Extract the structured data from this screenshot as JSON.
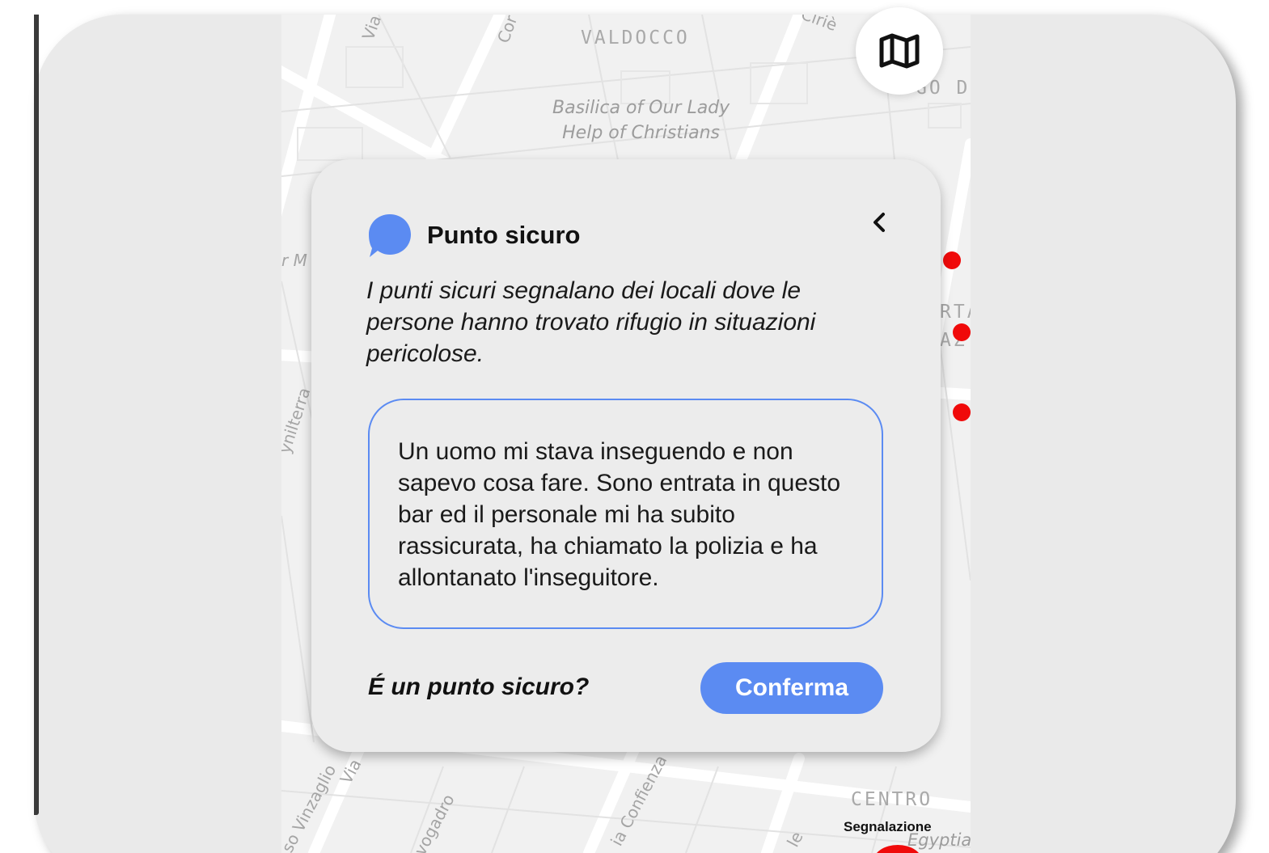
{
  "map": {
    "labels": {
      "valdocco": "VALDOCCO",
      "basilica": "Basilica of Our Lady\nHelp of Christians",
      "centro": "CENTRO",
      "egyptian": "Egyptia",
      "street_via_top": "Via",
      "street_cor": "Cor",
      "street_cirie": "Ciriè",
      "street_borgo": "GO D",
      "street_rm": "r M",
      "street_rta": "RTA",
      "street_az": "AZ",
      "street_cenilterra": "ynilterra",
      "street_vinzaglio": "so Vinzaglio",
      "street_via_bottom": "Via",
      "street_avogadro": "vogadro",
      "street_confienza": "ia Confienza",
      "street_le": "le"
    },
    "pin_color": "#f00a0a",
    "report_label": "Segnalazione",
    "toggle_icon": "map-icon"
  },
  "popup": {
    "icon": "speech-bubble-icon",
    "icon_color": "#5b8bf2",
    "title": "Punto sicuro",
    "back_icon": "chevron-left-icon",
    "description": "I punti sicuri segnalano dei locali dove le persone hanno trovato rifugio in situazioni pericolose.",
    "story": "Un uomo mi stava inseguendo e non sapevo cosa fare. Sono entrata in questo bar ed il personale mi ha subito rassicurata, ha chiamato la polizia e ha allontanato l'inseguitore.",
    "question": "É un punto sicuro?",
    "confirm_label": "Conferma",
    "accent_color": "#5b8bf2"
  }
}
